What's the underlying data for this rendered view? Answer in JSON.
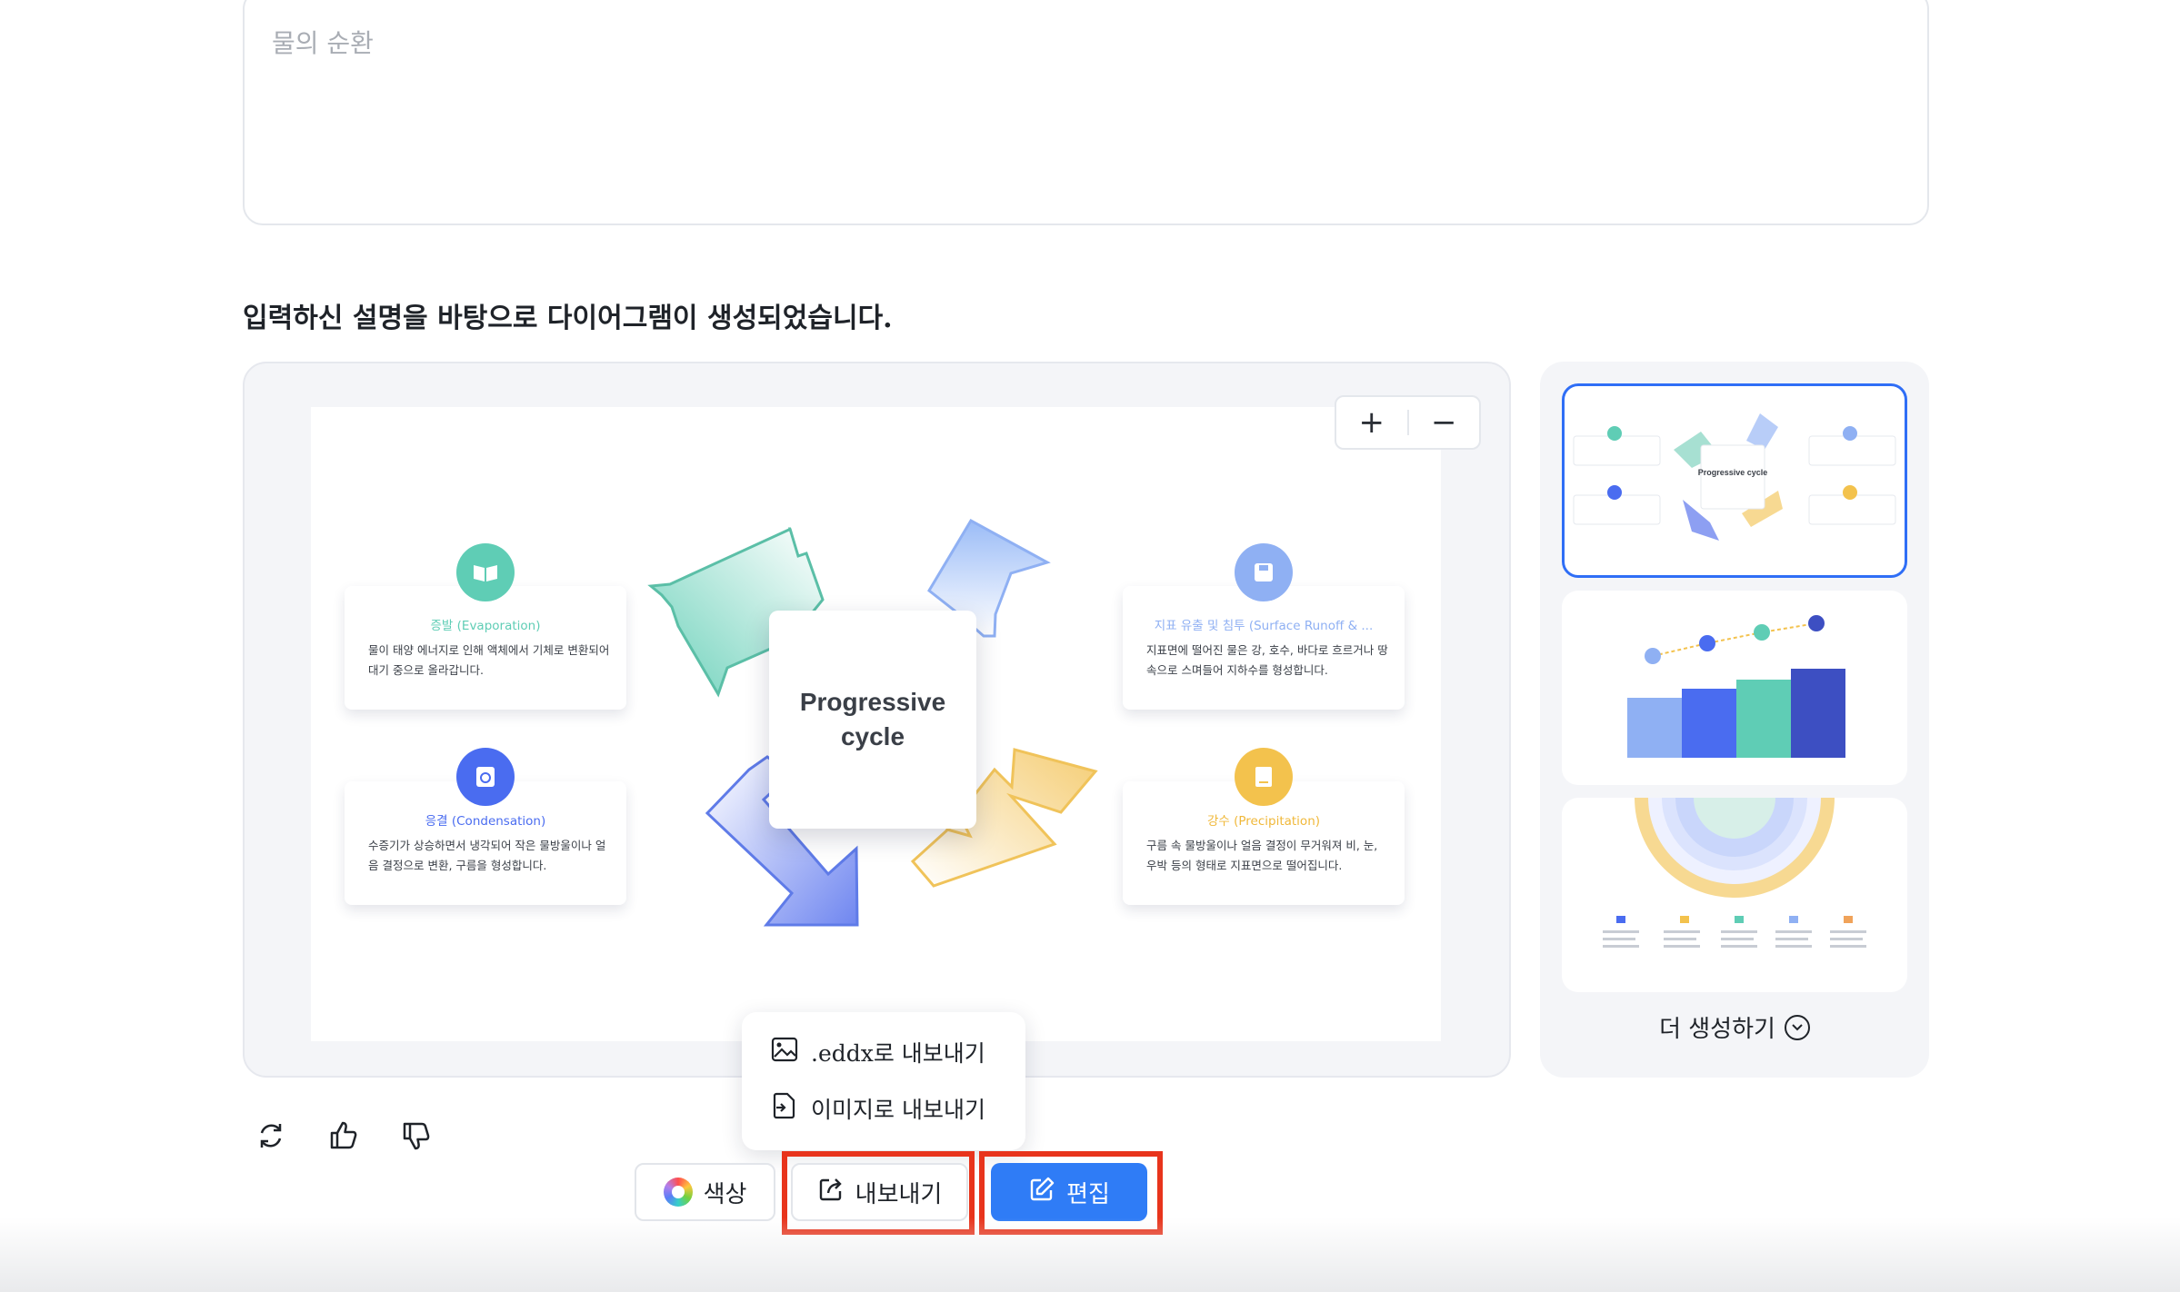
{
  "prompt_input": {
    "placeholder": "물의 순환"
  },
  "result_message": "입력하신 설명을 바탕으로 다이어그램이 생성되었습니다.",
  "canvas": {
    "zoom_in": "+",
    "zoom_out": "−",
    "center_title": "Progressive cycle",
    "cards": [
      {
        "title": "증발 (Evaporation)",
        "desc": "물이 태양 에너지로 인해 액체에서 기체로 변환되어 대기 중으로 올라갑니다.",
        "color": "#5fcdb5",
        "icon": "book-icon"
      },
      {
        "title": "응결 (Condensation)",
        "desc": "수증기가 상승하면서 냉각되어 작은 물방울이나 얼음 결정으로 변환, 구름을 형성합니다.",
        "color": "#4a6cf0",
        "icon": "clock-icon"
      },
      {
        "title": "지표 유출 및 침투 (Surface Runoff & ...",
        "desc": "지표면에 떨어진 물은 강, 호수, 바다로 흐르거나 땅속으로 스며들어 지하수를 형성합니다.",
        "color": "#8fb0f3",
        "icon": "save-icon"
      },
      {
        "title": "강수 (Precipitation)",
        "desc": "구름 속 물방울이나 얼음 결정이 무거워져 비, 눈, 우박 등의 형태로 지표면으로 떨어집니다.",
        "color": "#f3c24d",
        "icon": "notebook-icon"
      }
    ]
  },
  "thumbnails": {
    "items": [
      {
        "label": "Progressive cycle",
        "selected": true
      },
      {
        "label": "",
        "selected": false
      },
      {
        "label": "",
        "selected": false
      }
    ],
    "more_label": "더 생성하기"
  },
  "actions": {
    "regenerate": "refresh-icon",
    "like": "thumbs-up-icon",
    "dislike": "thumbs-down-icon"
  },
  "export_menu": {
    "items": [
      ".eddx로 내보내기",
      "이미지로 내보내기"
    ]
  },
  "toolbar": {
    "color_label": "색상",
    "export_label": "내보내기",
    "edit_label": "편집"
  },
  "colors": {
    "accent": "#2f7cf6",
    "highlight": "#e8341c"
  }
}
